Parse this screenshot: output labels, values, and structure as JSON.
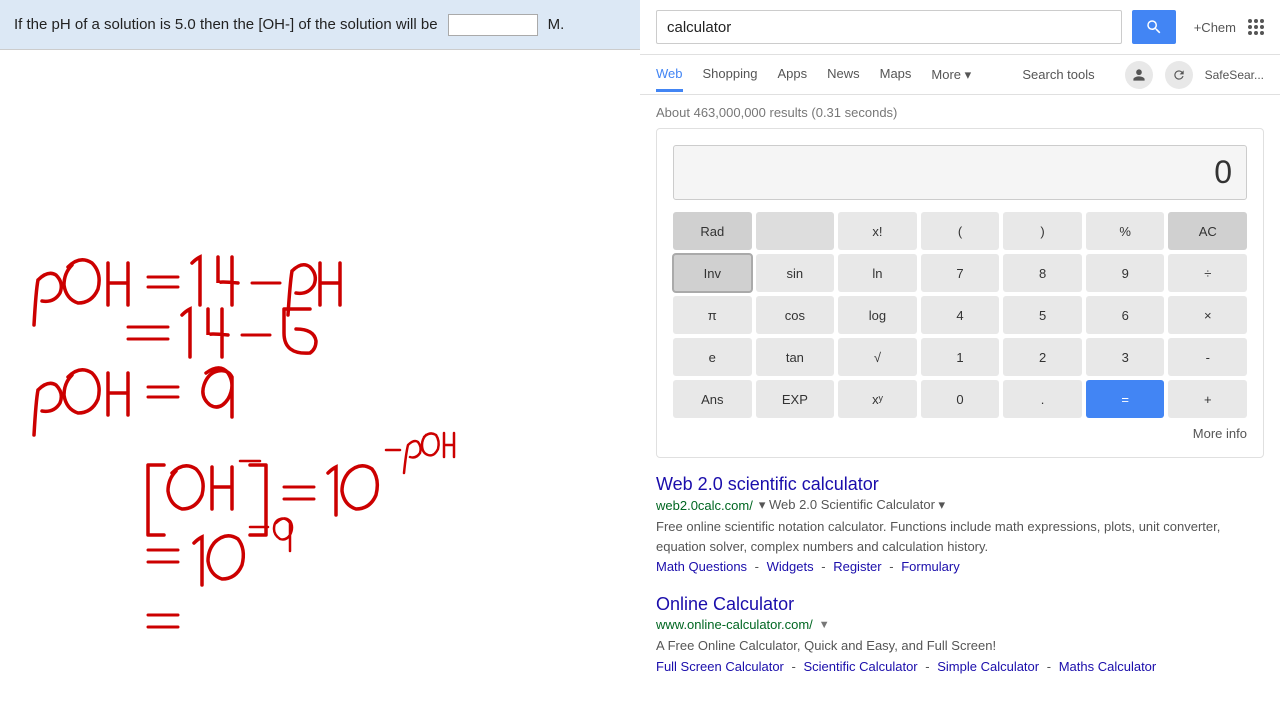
{
  "left": {
    "question": "If the pH of a solution is 5.0 then the [OH-] of the solution will be",
    "unit": "M."
  },
  "right": {
    "search": {
      "value": "calculator",
      "placeholder": "calculator"
    },
    "chem_label": "+Chem",
    "tabs": [
      {
        "label": "Web",
        "active": true
      },
      {
        "label": "Shopping",
        "active": false
      },
      {
        "label": "Apps",
        "active": false
      },
      {
        "label": "News",
        "active": false
      },
      {
        "label": "Maps",
        "active": false
      },
      {
        "label": "More",
        "active": false
      },
      {
        "label": "Search tools",
        "active": false
      }
    ],
    "safesearch_label": "SafeSear...",
    "results_count": "About 463,000,000 results (0.31 seconds)",
    "calculator": {
      "display_value": "0",
      "buttons_row1": [
        "Rad",
        "",
        "x!",
        "(",
        ")",
        "%",
        "AC"
      ],
      "buttons_row2": [
        "Inv",
        "sin",
        "ln",
        "7",
        "8",
        "9",
        "÷"
      ],
      "buttons_row3": [
        "π",
        "cos",
        "log",
        "4",
        "5",
        "6",
        "×"
      ],
      "buttons_row4": [
        "e",
        "tan",
        "√",
        "1",
        "2",
        "3",
        "-"
      ],
      "buttons_row5": [
        "Ans",
        "EXP",
        "xʸ",
        "0",
        ".",
        "=",
        "+"
      ]
    },
    "more_info_label": "More info",
    "results": [
      {
        "title": "Web 2.0 scientific calculator",
        "url": "web2.0calc.com/",
        "url_dropdown": "▼",
        "subtitle": "Web 2.0 Scientific Calculator ▾",
        "desc": "Free online scientific notation calculator. Functions include math expressions, plots, unit converter, equation solver, complex numbers and calculation history.",
        "links": [
          "Math Questions",
          "Widgets",
          "Register",
          "Formulary"
        ]
      },
      {
        "title": "Online Calculator",
        "url": "www.online-calculator.com/",
        "url_dropdown": "▼",
        "desc": "A Free Online Calculator, Quick and Easy, and Full Screen!",
        "links": [
          "Full Screen Calculator",
          "Scientific Calculator",
          "Simple Calculator",
          "Maths Calculator"
        ]
      }
    ]
  }
}
